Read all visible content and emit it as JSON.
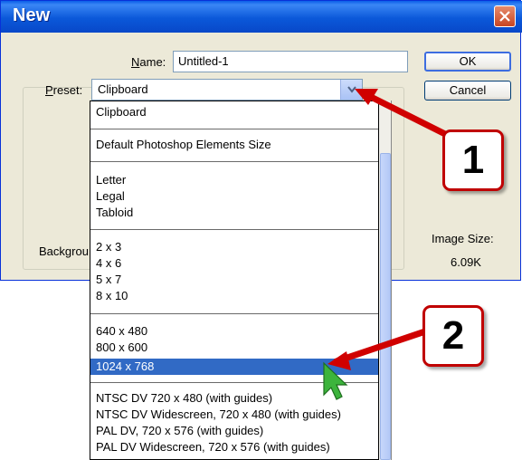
{
  "window": {
    "title": "New"
  },
  "form": {
    "name_label": "Name:",
    "name_value": "Untitled-1",
    "preset_label": "Preset:",
    "preset_value": "Clipboard",
    "background_label": "Backgrou",
    "image_size_label": "Image Size:",
    "image_size_value": "6.09K"
  },
  "buttons": {
    "ok": "OK",
    "cancel": "Cancel"
  },
  "dropdown": {
    "groups": [
      [
        "Clipboard"
      ],
      [
        "Default Photoshop Elements Size"
      ],
      [
        "Letter",
        "Legal",
        "Tabloid"
      ],
      [
        "2 x 3",
        "4 x 6",
        "5 x 7",
        "8 x 10"
      ],
      [
        "640 x 480",
        "800 x 600",
        "1024 x 768"
      ],
      [
        "NTSC DV 720 x 480 (with guides)",
        "NTSC DV Widescreen, 720 x 480 (with guides)",
        "PAL DV, 720 x 576 (with guides)",
        "PAL DV Widescreen, 720 x 576 (with guides)"
      ]
    ],
    "selected": "1024 x 768"
  },
  "callouts": {
    "one": "1",
    "two": "2"
  },
  "colors": {
    "title_bar": "#0b58d9",
    "selection": "#316ac5",
    "callout_border": "#c00000",
    "cursor": "#3cb43c"
  }
}
